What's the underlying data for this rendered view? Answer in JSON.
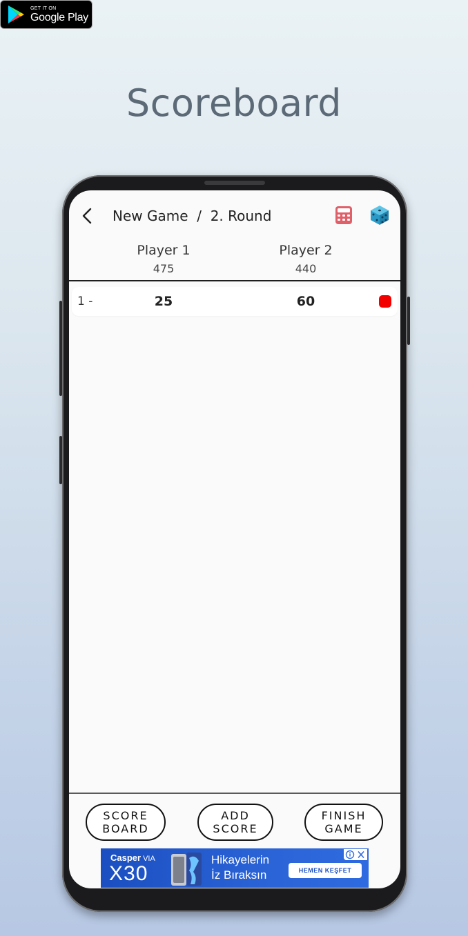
{
  "store_badge": {
    "small": "GET IT ON",
    "big": "Google Play"
  },
  "heading": "Scoreboard",
  "app": {
    "title": "New Game  /  2. Round",
    "icons": {
      "back": "chevron-left-icon",
      "calculator": "calculator-icon",
      "dice": "dice-icon"
    },
    "players": [
      {
        "name": "Player 1",
        "total": "475"
      },
      {
        "name": "Player 2",
        "total": "440"
      }
    ],
    "rounds": [
      {
        "label": "1 -",
        "scores": [
          "25",
          "60"
        ]
      }
    ],
    "buttons": {
      "scoreboard": [
        "SCORE",
        "BOARD"
      ],
      "add_score": [
        "ADD",
        "SCORE"
      ],
      "finish_game": [
        "FINISH",
        "GAME"
      ]
    },
    "colors": {
      "delete_marker": "#f20000",
      "accent_calc": "#e0606a",
      "accent_dice": "#2a9bc8"
    }
  },
  "ad": {
    "brand": "Casper",
    "via": "VIA",
    "model": "X30",
    "slogan_line1": "Hikayelerin",
    "slogan_line2": "İz Bıraksın",
    "cta": "HEMEN KEŞFET"
  }
}
